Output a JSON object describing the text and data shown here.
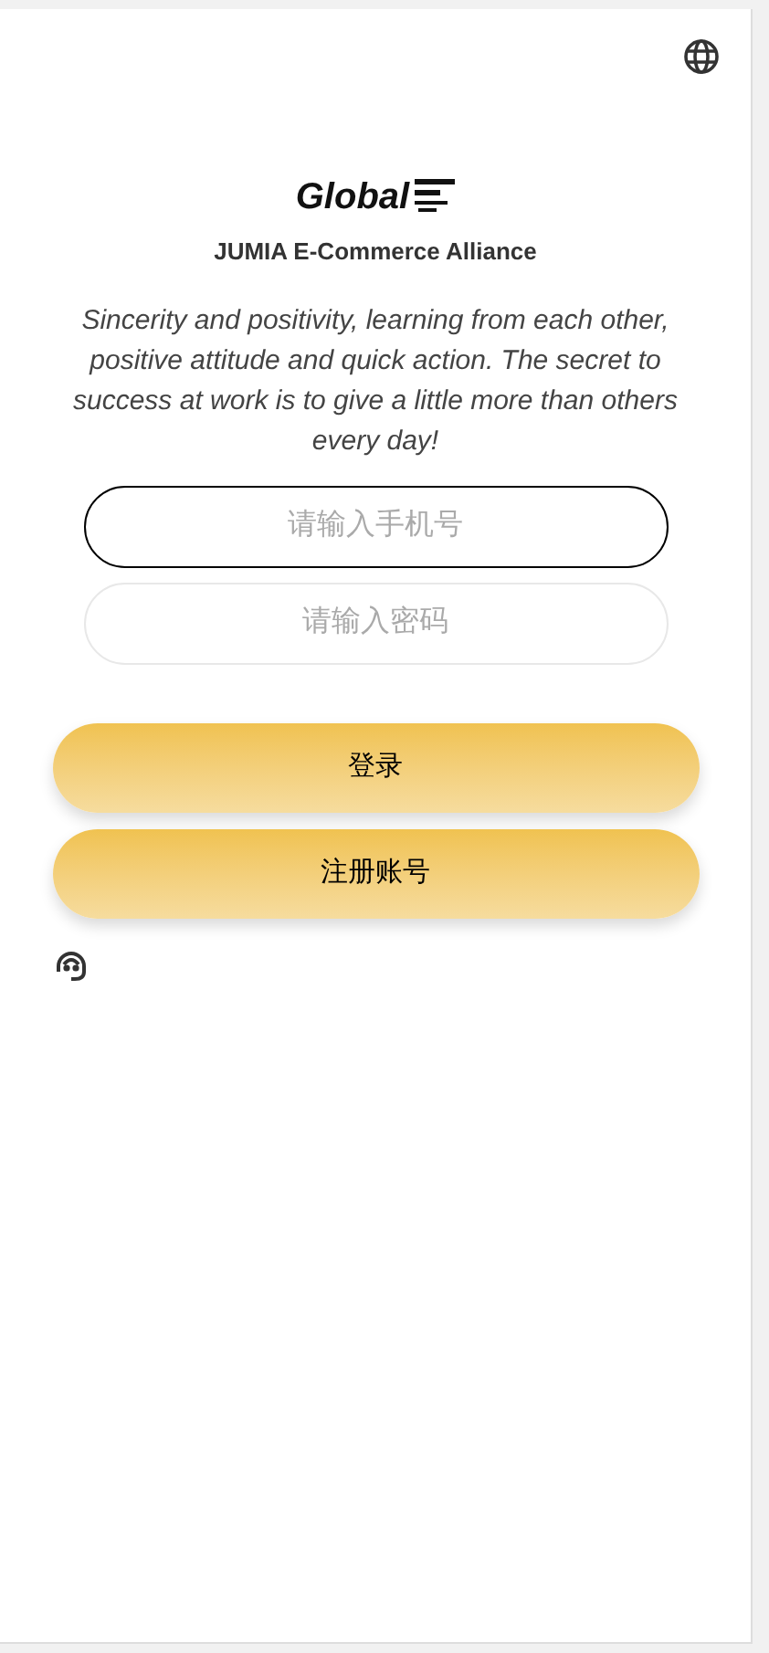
{
  "logo": {
    "text": "Global"
  },
  "brand": "JUMIA E-Commerce Alliance",
  "motto": "Sincerity and positivity, learning from each other, positive attitude and quick action. The secret to success at work is to give a little more than others every day!",
  "fields": [
    {
      "placeholder": "请输入手机号",
      "focused": true
    },
    {
      "placeholder": "请输入密码",
      "focused": false
    }
  ],
  "buttons": [
    "登录",
    "注册账号"
  ]
}
